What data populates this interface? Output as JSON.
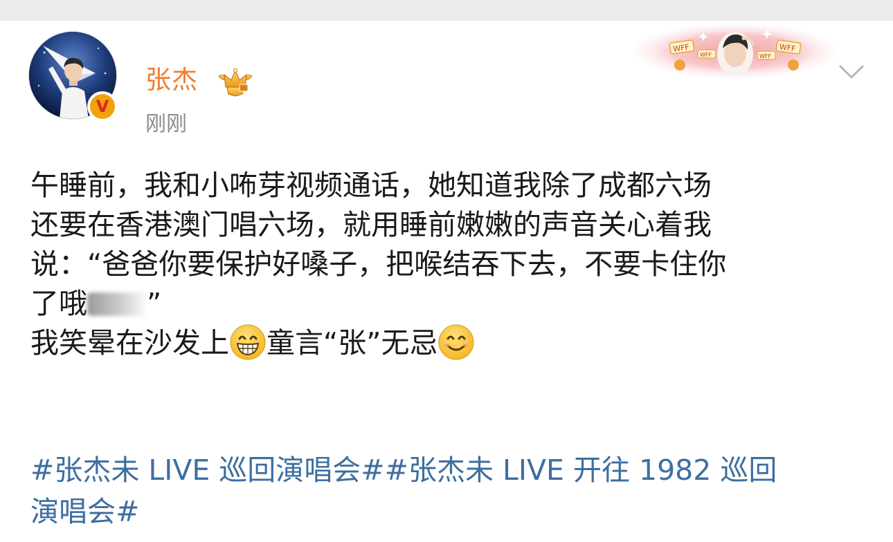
{
  "post": {
    "author": {
      "name": "张杰",
      "verified_letter": "V",
      "avatar": "avatar-photo",
      "badge_icon": "crown-icon"
    },
    "time": "刚刚",
    "decoration_labels": [
      "WFF",
      "WFF",
      "WFF",
      "WFF"
    ],
    "menu_icon": "chevron-down-icon",
    "body": {
      "line1": "午睡前，我和小咘芽视频通话，她知道我除了成都六场",
      "line2": "还要在香港澳门唱六场，就用睡前嫩嫩的声音关心着我",
      "line3": "说：“爸爸你要保护好嗓子，把喉结吞下去，不要卡住你",
      "line4_prefix": "了哦",
      "line4_suffix": "”",
      "line5_part1": "我笑晕在沙发上",
      "line5_part2": "童言“张”无忌",
      "emoji1": "grinning-face-icon",
      "emoji2": "smiling-face-icon"
    },
    "hashtags": {
      "tag1": "#张杰未 LIVE 巡回演唱会#",
      "tag2_line1": "#张杰未 LIVE 开往 1982 巡回",
      "tag2_line2": "演唱会#"
    }
  },
  "colors": {
    "username": "#f07c28",
    "hashtag": "#3d6e9f",
    "body_text": "#1a1a1a",
    "timestamp": "#8a8a8a",
    "verified_badge": "#f2a20c"
  }
}
